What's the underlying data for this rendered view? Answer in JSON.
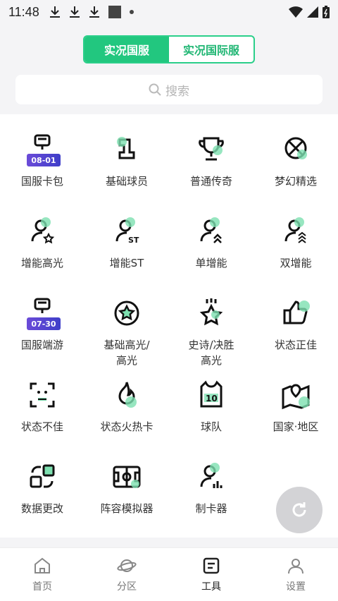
{
  "status": {
    "time": "11:48"
  },
  "segment": {
    "active": "实况国服",
    "inactive": "实况国际服"
  },
  "search": {
    "placeholder": "搜索"
  },
  "tiles": [
    {
      "label": "国服卡包",
      "badge": "08-01",
      "icon": "card-pack-icon"
    },
    {
      "label": "基础球员",
      "icon": "base-player-icon"
    },
    {
      "label": "普通传奇",
      "icon": "trophy-icon"
    },
    {
      "label": "梦幻精选",
      "icon": "dream-select-icon"
    },
    {
      "label": "增能高光",
      "icon": "user-star-icon"
    },
    {
      "label": "增能ST",
      "icon": "user-st-icon"
    },
    {
      "label": "单增能",
      "icon": "user-single-boost-icon"
    },
    {
      "label": "双增能",
      "icon": "user-double-boost-icon"
    },
    {
      "label": "国服端游",
      "badge": "07-30",
      "icon": "pc-game-icon"
    },
    {
      "label": "基础高光/\n高光",
      "icon": "star-circle-icon"
    },
    {
      "label": "史诗/决胜\n高光",
      "icon": "epic-star-icon"
    },
    {
      "label": "状态正佳",
      "icon": "thumbs-up-icon"
    },
    {
      "label": "状态不佳",
      "icon": "scan-face-icon"
    },
    {
      "label": "状态火热卡",
      "icon": "fire-icon"
    },
    {
      "label": "球队",
      "icon": "jersey-icon"
    },
    {
      "label": "国家·地区",
      "icon": "map-pin-icon"
    },
    {
      "label": "数据更改",
      "icon": "data-change-icon"
    },
    {
      "label": "阵容模拟器",
      "icon": "pitch-icon"
    },
    {
      "label": "制卡器",
      "icon": "card-maker-icon"
    }
  ],
  "tabs": [
    {
      "label": "首页",
      "icon": "home-icon"
    },
    {
      "label": "分区",
      "icon": "planet-icon"
    },
    {
      "label": "工具",
      "icon": "tools-icon"
    },
    {
      "label": "设置",
      "icon": "user-icon"
    }
  ]
}
